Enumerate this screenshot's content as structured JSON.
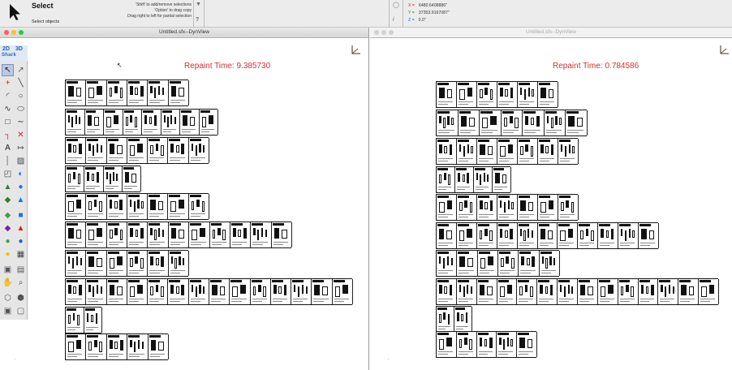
{
  "toolbar": {
    "tool_name": "Select",
    "tool_desc": "Select objects",
    "hints": [
      "'Shift' to add/remove selections",
      "'Option' to drag copy",
      "Drag right to left for partial selection"
    ],
    "coords": {
      "x_label": "X =",
      "x_value": "6480.6408886\"",
      "y_label": "Y =",
      "y_value": "37353.9167087\"",
      "z_label": "Z =",
      "z_value": "0.0\""
    },
    "info_icon": "i"
  },
  "left_window": {
    "title": "Untitled.sfx--DynView",
    "repaint": "Repaint Time: 9.385730"
  },
  "right_window": {
    "title": "Untitled.sfx--DynView",
    "repaint": "Repaint Time: 0.784586"
  },
  "palette": {
    "mode_2d": "2D",
    "mode_3d": "3D",
    "brand": "Shark",
    "tools": [
      "arrow-select-icon",
      "direct-select-icon",
      "point-icon",
      "line-icon",
      "arc-icon",
      "circle-icon",
      "curve-icon",
      "ellipse-icon",
      "rectangle-icon",
      "spline-icon",
      "corner-icon",
      "trim-icon",
      "text-icon",
      "dimension-icon",
      "measure-icon",
      "hatch-icon",
      "transform-icon",
      "mirror-icon",
      "extrude-icon",
      "sphere-icon",
      "revolve-icon",
      "sweep-icon",
      "loft-icon",
      "solid-icon",
      "surface-icon",
      "shell-icon",
      "boolean-icon",
      "render-icon",
      "light-icon",
      "texture-icon",
      "camera-icon",
      "layer-icon",
      "pan-hand-icon",
      "zoom-icon",
      "view-iso-icon",
      "view-top-icon",
      "view-front-icon",
      "view-right-icon"
    ]
  },
  "colors": {
    "repaint_red": "#d32f2f",
    "close": "#ff5f57",
    "minimize": "#febc2e",
    "zoom": "#28c840",
    "inactive_light": "#d0d0d0"
  }
}
